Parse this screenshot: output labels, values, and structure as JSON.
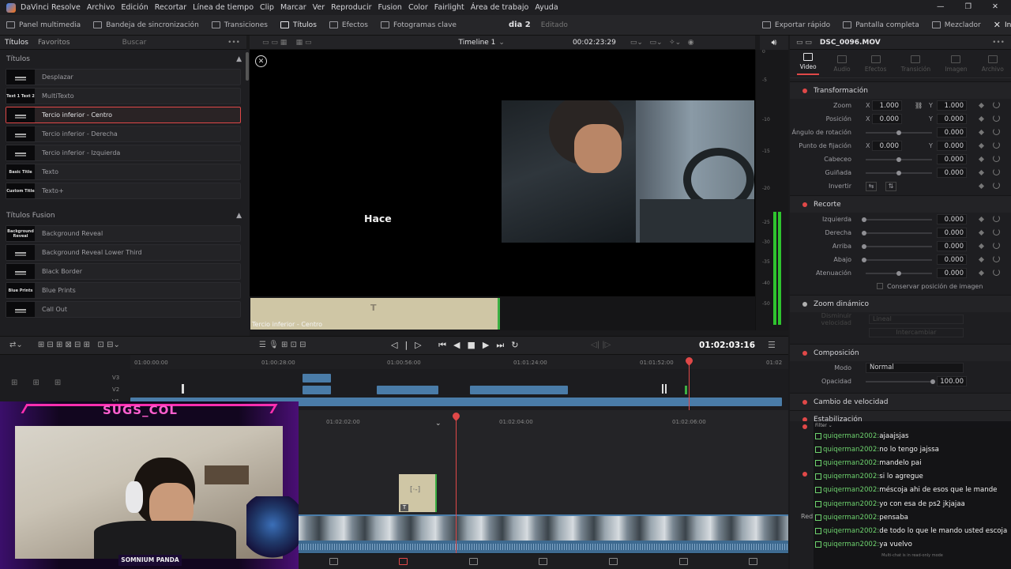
{
  "menu": {
    "app": "DaVinci Resolve",
    "items": [
      "Archivo",
      "Edición",
      "Recortar",
      "Línea de tiempo",
      "Clip",
      "Marcar",
      "Ver",
      "Reproducir",
      "Fusion",
      "Color",
      "Fairlight",
      "Área de trabajo",
      "Ayuda"
    ]
  },
  "toolbar": {
    "panel_multimedia": "Panel multimedia",
    "bandeja": "Bandeja de sincronización",
    "transiciones": "Transiciones",
    "titulos": "Títulos",
    "efectos": "Efectos",
    "fotogramas": "Fotogramas clave",
    "project": "dia 2",
    "status": "Editado",
    "exportar": "Exportar rápido",
    "pantalla": "Pantalla completa",
    "mezclador": "Mezclador",
    "inspector": "Inspector"
  },
  "left_panel": {
    "tab_titulos": "Títulos",
    "tab_favoritos": "Favoritos",
    "search": "Buscar",
    "section1": "Títulos",
    "items1": [
      {
        "label": "Desplazar",
        "thumb": "scroll"
      },
      {
        "label": "MultiTexto",
        "thumb": "Text 1 Text 2"
      },
      {
        "label": "Tercio inferior - Centro",
        "thumb": "lower"
      },
      {
        "label": "Tercio inferior - Derecha",
        "thumb": "lower"
      },
      {
        "label": "Tercio inferior - Izquierda",
        "thumb": "lower"
      },
      {
        "label": "Texto",
        "thumb": "Basic Title"
      },
      {
        "label": "Texto+",
        "thumb": "Custom Title"
      }
    ],
    "section2": "Títulos Fusion",
    "items2": [
      {
        "label": "Background Reveal",
        "thumb": "Background Reveal"
      },
      {
        "label": "Background Reveal Lower Third",
        "thumb": ""
      },
      {
        "label": "Black Border",
        "thumb": ""
      },
      {
        "label": "Blue Prints",
        "thumb": "Blue Prints"
      },
      {
        "label": "Call Out",
        "thumb": ""
      }
    ]
  },
  "viewer": {
    "timeline_name": "Timeline 1",
    "timecode": "00:02:23:29",
    "overlay_text": "Hace",
    "clip_label": "Tercio inferior - Centro"
  },
  "meter": {
    "labels": [
      "0",
      "-5",
      "-10",
      "-15",
      "-20",
      "-25",
      "-30",
      "-35",
      "-40",
      "-50"
    ]
  },
  "inspector": {
    "clip": "DSC_0096.MOV",
    "tabs": [
      {
        "label": "Video",
        "on": true
      },
      {
        "label": "Audio",
        "on": false
      },
      {
        "label": "Efectos",
        "on": false
      },
      {
        "label": "Transición",
        "on": false
      },
      {
        "label": "Imagen",
        "on": false
      },
      {
        "label": "Archivo",
        "on": false
      }
    ],
    "transform": "Transformación",
    "zoom": "Zoom",
    "zoom_x": "1.000",
    "zoom_y": "1.000",
    "posicion": "Posición",
    "pos_x": "0.000",
    "pos_y": "0.000",
    "angulo": "Ángulo de rotación",
    "angulo_v": "0.000",
    "fijacion": "Punto de fijación",
    "fij_x": "0.000",
    "fij_y": "0.000",
    "cabeceo": "Cabeceo",
    "cabeceo_v": "0.000",
    "guinada": "Guiñada",
    "guinada_v": "0.000",
    "invertir": "Invertir",
    "recorte": "Recorte",
    "izquierda": "Izquierda",
    "izquierda_v": "0.000",
    "derecha": "Derecha",
    "derecha_v": "0.000",
    "arriba": "Arriba",
    "arriba_v": "0.000",
    "abajo": "Abajo",
    "abajo_v": "0.000",
    "atenuacion": "Atenuación",
    "atenuacion_v": "0.000",
    "conservar": "Conservar posición de imagen",
    "zoom_din": "Zoom dinámico",
    "disminuir": "Disminuir velocidad",
    "lineal": "Lineal",
    "intercambiar": "Intercambiar",
    "composicion": "Composición",
    "modo": "Modo",
    "modo_v": "Normal",
    "opacidad": "Opacidad",
    "opacidad_v": "100.00",
    "cambio_vel": "Cambio de velocidad",
    "estabilizacion": "Estabilización"
  },
  "transport": {
    "timecode": "01:02:03:16"
  },
  "timeline": {
    "upper_ticks": [
      "01:00:00:00",
      "01:00:28:00",
      "01:00:56:00",
      "01:01:24:00",
      "01:01:52:00",
      "01:02"
    ],
    "tracks": [
      "V3",
      "V2",
      "V1"
    ],
    "lower_ticks": [
      "01:02:02:00",
      "01:02:04:00",
      "01:02:06:00"
    ]
  },
  "stream": {
    "name": "SUGS_COL",
    "badge": "SOMNIUM PANDA"
  },
  "chat": {
    "filter": "Filter",
    "user": "quiqerman2002:",
    "messages": [
      "ajaajsjas",
      "no lo tengo jajssa",
      "mandelo pai",
      "si lo agregue",
      "méscoja ahi de esos que le mande",
      "yo con esa de ps2 jkjajaa",
      "pensaba",
      "de todo lo que le mando usted escoja",
      "ya vuelvo"
    ],
    "footer": "Multi-chat is in read-only mode",
    "redi": "Redi"
  },
  "colors": {
    "accent": "#e04848",
    "blue": "#4a7ca8",
    "green": "#3cb043",
    "chat_user": "#6ed36e"
  }
}
